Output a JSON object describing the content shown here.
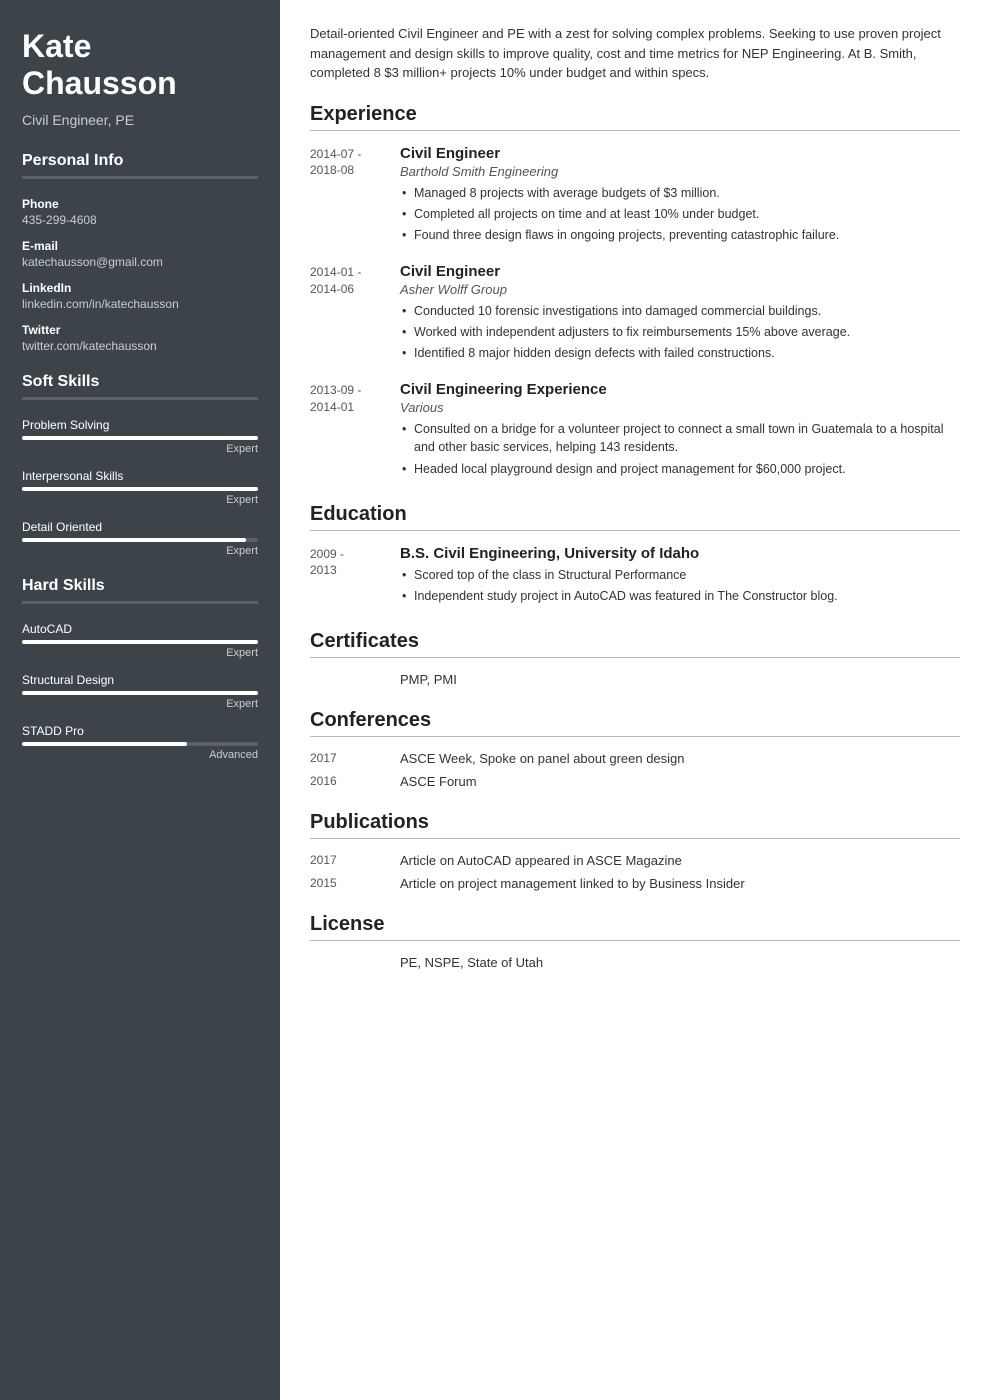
{
  "sidebar": {
    "name": "Kate\nChausson",
    "name_line1": "Kate",
    "name_line2": "Chausson",
    "job_title": "Civil Engineer, PE",
    "personal_info_heading": "Personal Info",
    "contact": [
      {
        "label": "Phone",
        "value": "435-299-4608"
      },
      {
        "label": "E-mail",
        "value": "katechausson@gmail.com"
      },
      {
        "label": "LinkedIn",
        "value": "linkedin.com/in/katechausson"
      },
      {
        "label": "Twitter",
        "value": "twitter.com/katechausson"
      }
    ],
    "soft_skills_heading": "Soft Skills",
    "soft_skills": [
      {
        "name": "Problem Solving",
        "level": "Expert",
        "pct": 100
      },
      {
        "name": "Interpersonal Skills",
        "level": "Expert",
        "pct": 100
      },
      {
        "name": "Detail Oriented",
        "level": "Expert",
        "pct": 95
      }
    ],
    "hard_skills_heading": "Hard Skills",
    "hard_skills": [
      {
        "name": "AutoCAD",
        "level": "Expert",
        "pct": 100
      },
      {
        "name": "Structural Design",
        "level": "Expert",
        "pct": 100
      },
      {
        "name": "STADD Pro",
        "level": "Advanced",
        "pct": 70
      }
    ]
  },
  "main": {
    "summary": "Detail-oriented Civil Engineer and PE with a zest for solving complex problems. Seeking to use proven project management and design skills to improve quality, cost and time metrics for NEP Engineering. At B. Smith, completed 8 $3 million+ projects 10% under budget and within specs.",
    "experience_heading": "Experience",
    "experience": [
      {
        "date": "2014-07 -\n2018-08",
        "title": "Civil Engineer",
        "company": "Barthold Smith Engineering",
        "bullets": [
          "Managed 8 projects with average budgets of $3 million.",
          "Completed all projects on time and at least 10% under budget.",
          "Found three design flaws in ongoing projects, preventing catastrophic failure."
        ]
      },
      {
        "date": "2014-01 -\n2014-06",
        "title": "Civil Engineer",
        "company": "Asher Wolff Group",
        "bullets": [
          "Conducted 10 forensic investigations into damaged commercial buildings.",
          "Worked with independent adjusters to fix reimbursements 15% above average.",
          "Identified 8 major hidden design defects with failed constructions."
        ]
      },
      {
        "date": "2013-09 -\n2014-01",
        "title": "Civil Engineering Experience",
        "company": "Various",
        "bullets": [
          "Consulted on a bridge for a volunteer project to connect a small town in Guatemala to a hospital and other basic services, helping 143 residents.",
          "Headed local playground design and project management for $60,000 project."
        ]
      }
    ],
    "education_heading": "Education",
    "education": [
      {
        "date": "2009 -\n2013",
        "degree": "B.S. Civil Engineering, University of Idaho",
        "bullets": [
          "Scored top of the class in Structural Performance",
          "Independent study project in AutoCAD was featured in The Constructor blog."
        ]
      }
    ],
    "certificates_heading": "Certificates",
    "certificates": "PMP, PMI",
    "conferences_heading": "Conferences",
    "conferences": [
      {
        "year": "2017",
        "text": "ASCE Week, Spoke on panel about green design"
      },
      {
        "year": "2016",
        "text": "ASCE Forum"
      }
    ],
    "publications_heading": "Publications",
    "publications": [
      {
        "year": "2017",
        "text": "Article on AutoCAD appeared in ASCE Magazine"
      },
      {
        "year": "2015",
        "text": "Article on project management linked to by Business Insider"
      }
    ],
    "license_heading": "License",
    "license": "PE, NSPE, State of Utah"
  }
}
